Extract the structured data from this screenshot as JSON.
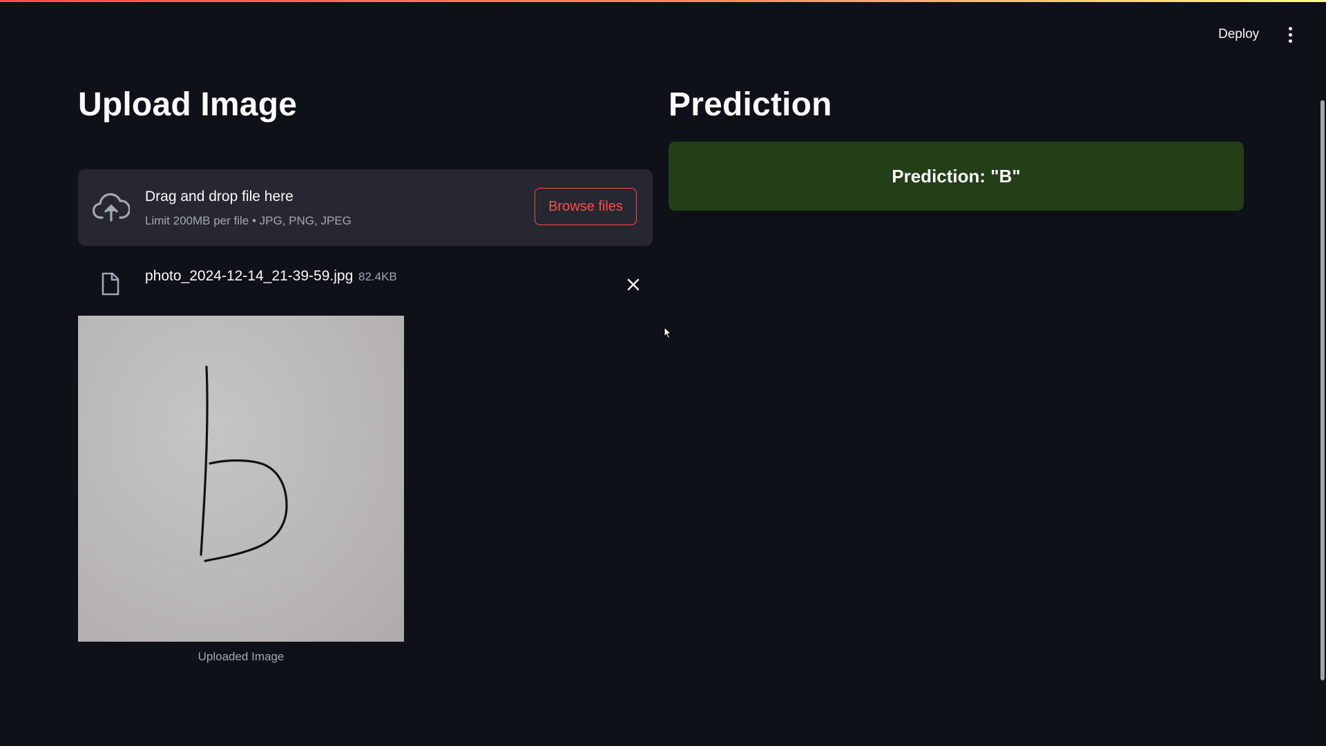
{
  "header": {
    "deploy_label": "Deploy",
    "menu_icon": "more-vertical-icon"
  },
  "upload_section": {
    "title": "Upload Image",
    "dropzone": {
      "icon": "cloud-upload-icon",
      "title": "Drag and drop file here",
      "limit_text": "Limit 200MB per file • JPG, PNG, JPEG",
      "browse_label": "Browse files"
    },
    "uploaded_file": {
      "icon": "file-icon",
      "name": "photo_2024-12-14_21-39-59.jpg",
      "size": "82.4KB",
      "remove_icon": "close-icon"
    },
    "image_caption": "Uploaded Image"
  },
  "prediction_section": {
    "title": "Prediction",
    "result_text": "Prediction: \"B\""
  },
  "colors": {
    "background": "#0e1117",
    "panel": "#262730",
    "accent": "#ff4b4b",
    "success_bg": "#243e17",
    "text": "#fafafa",
    "muted_text": "#a3a8b4"
  }
}
